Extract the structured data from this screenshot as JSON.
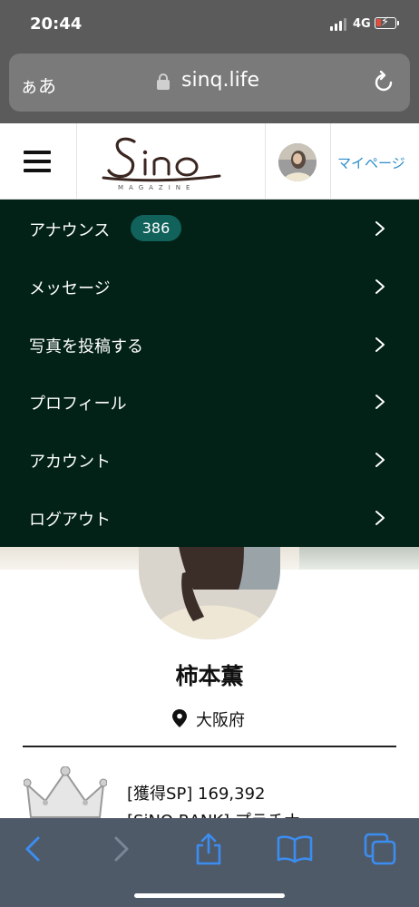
{
  "status_bar": {
    "time": "20:44",
    "network": "4G"
  },
  "browser": {
    "text_size_label": "ぁあ",
    "domain": "sinq.life"
  },
  "header": {
    "logo_text": "Sinq",
    "logo_subtitle": "MAGAZINE",
    "mypage_label": "マイページ"
  },
  "menu": {
    "items": [
      {
        "label": "アナウンス",
        "badge": "386"
      },
      {
        "label": "メッセージ"
      },
      {
        "label": "写真を投稿する"
      },
      {
        "label": "プロフィール"
      },
      {
        "label": "アカウント"
      },
      {
        "label": "ログアウト"
      }
    ]
  },
  "profile": {
    "name": "柿本薫",
    "location": "大阪府",
    "sp_line": "[獲得SP] 169,392",
    "rank_line": "[SiNQ RANK] プラチナ"
  },
  "icons": [
    "back-icon",
    "forward-icon",
    "share-icon",
    "bookmarks-icon",
    "tabs-icon",
    "lock-icon",
    "reload-icon",
    "hamburger-icon",
    "location-pin-icon",
    "crown-icon",
    "chevron-right-icon"
  ],
  "colors": {
    "menu_bg": "#022117",
    "badge_bg": "#11625b",
    "link": "#2d8ec9",
    "toolbar_bg": "#4f5a69",
    "chrome_bg": "#5b5b5b"
  }
}
